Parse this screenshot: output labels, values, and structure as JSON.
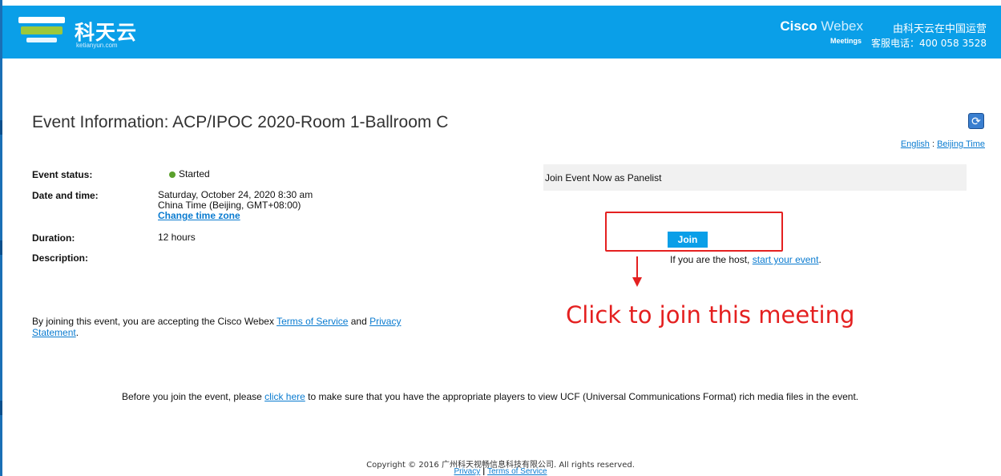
{
  "header": {
    "logo_cn": "科天云",
    "logo_en": "ketianyun.com",
    "cisco": "Cisco",
    "webex": "Webex",
    "meetings": "Meetings",
    "operator": "由科天云在中国运营",
    "phone": "客服电话：400 058 3528"
  },
  "event": {
    "title": "Event Information: ACP/IPOC 2020-Room 1-Ballroom C",
    "language_link": "English",
    "separator": ":",
    "timezone_link": "Beijing Time",
    "status_label": "Event status:",
    "status_value": "Started",
    "datetime_label": "Date and time:",
    "datetime_line1": "Saturday, October 24, 2020 8:30 am",
    "datetime_line2": "China Time (Beijing, GMT+08:00)",
    "change_tz_link": "Change time zone",
    "duration_label": "Duration:",
    "duration_value": "12 hours",
    "description_label": "Description:"
  },
  "join": {
    "panel_text": "Join Event Now as Panelist",
    "button_label": "Join",
    "host_prefix": "If you are the host, ",
    "host_link": "start your event",
    "host_suffix": ".",
    "annotation": "Click to join this meeting"
  },
  "terms": {
    "prefix": "By joining this event, you are accepting the Cisco Webex ",
    "tos_link": "Terms of Service",
    "and": " and ",
    "privacy_link": "Privacy Statement",
    "suffix": "."
  },
  "before": {
    "prefix": "Before you join the event, please ",
    "link": "click here",
    "suffix": " to make sure that you have the appropriate players to view UCF (Universal Communications Format) rich media files in the event."
  },
  "footer": {
    "copyright": "Copyright © 2016 广州科天视畅信息科技有限公司. All rights reserved.",
    "privacy_link": "Privacy",
    "divider": "|",
    "tos_link": "Terms of Service"
  }
}
